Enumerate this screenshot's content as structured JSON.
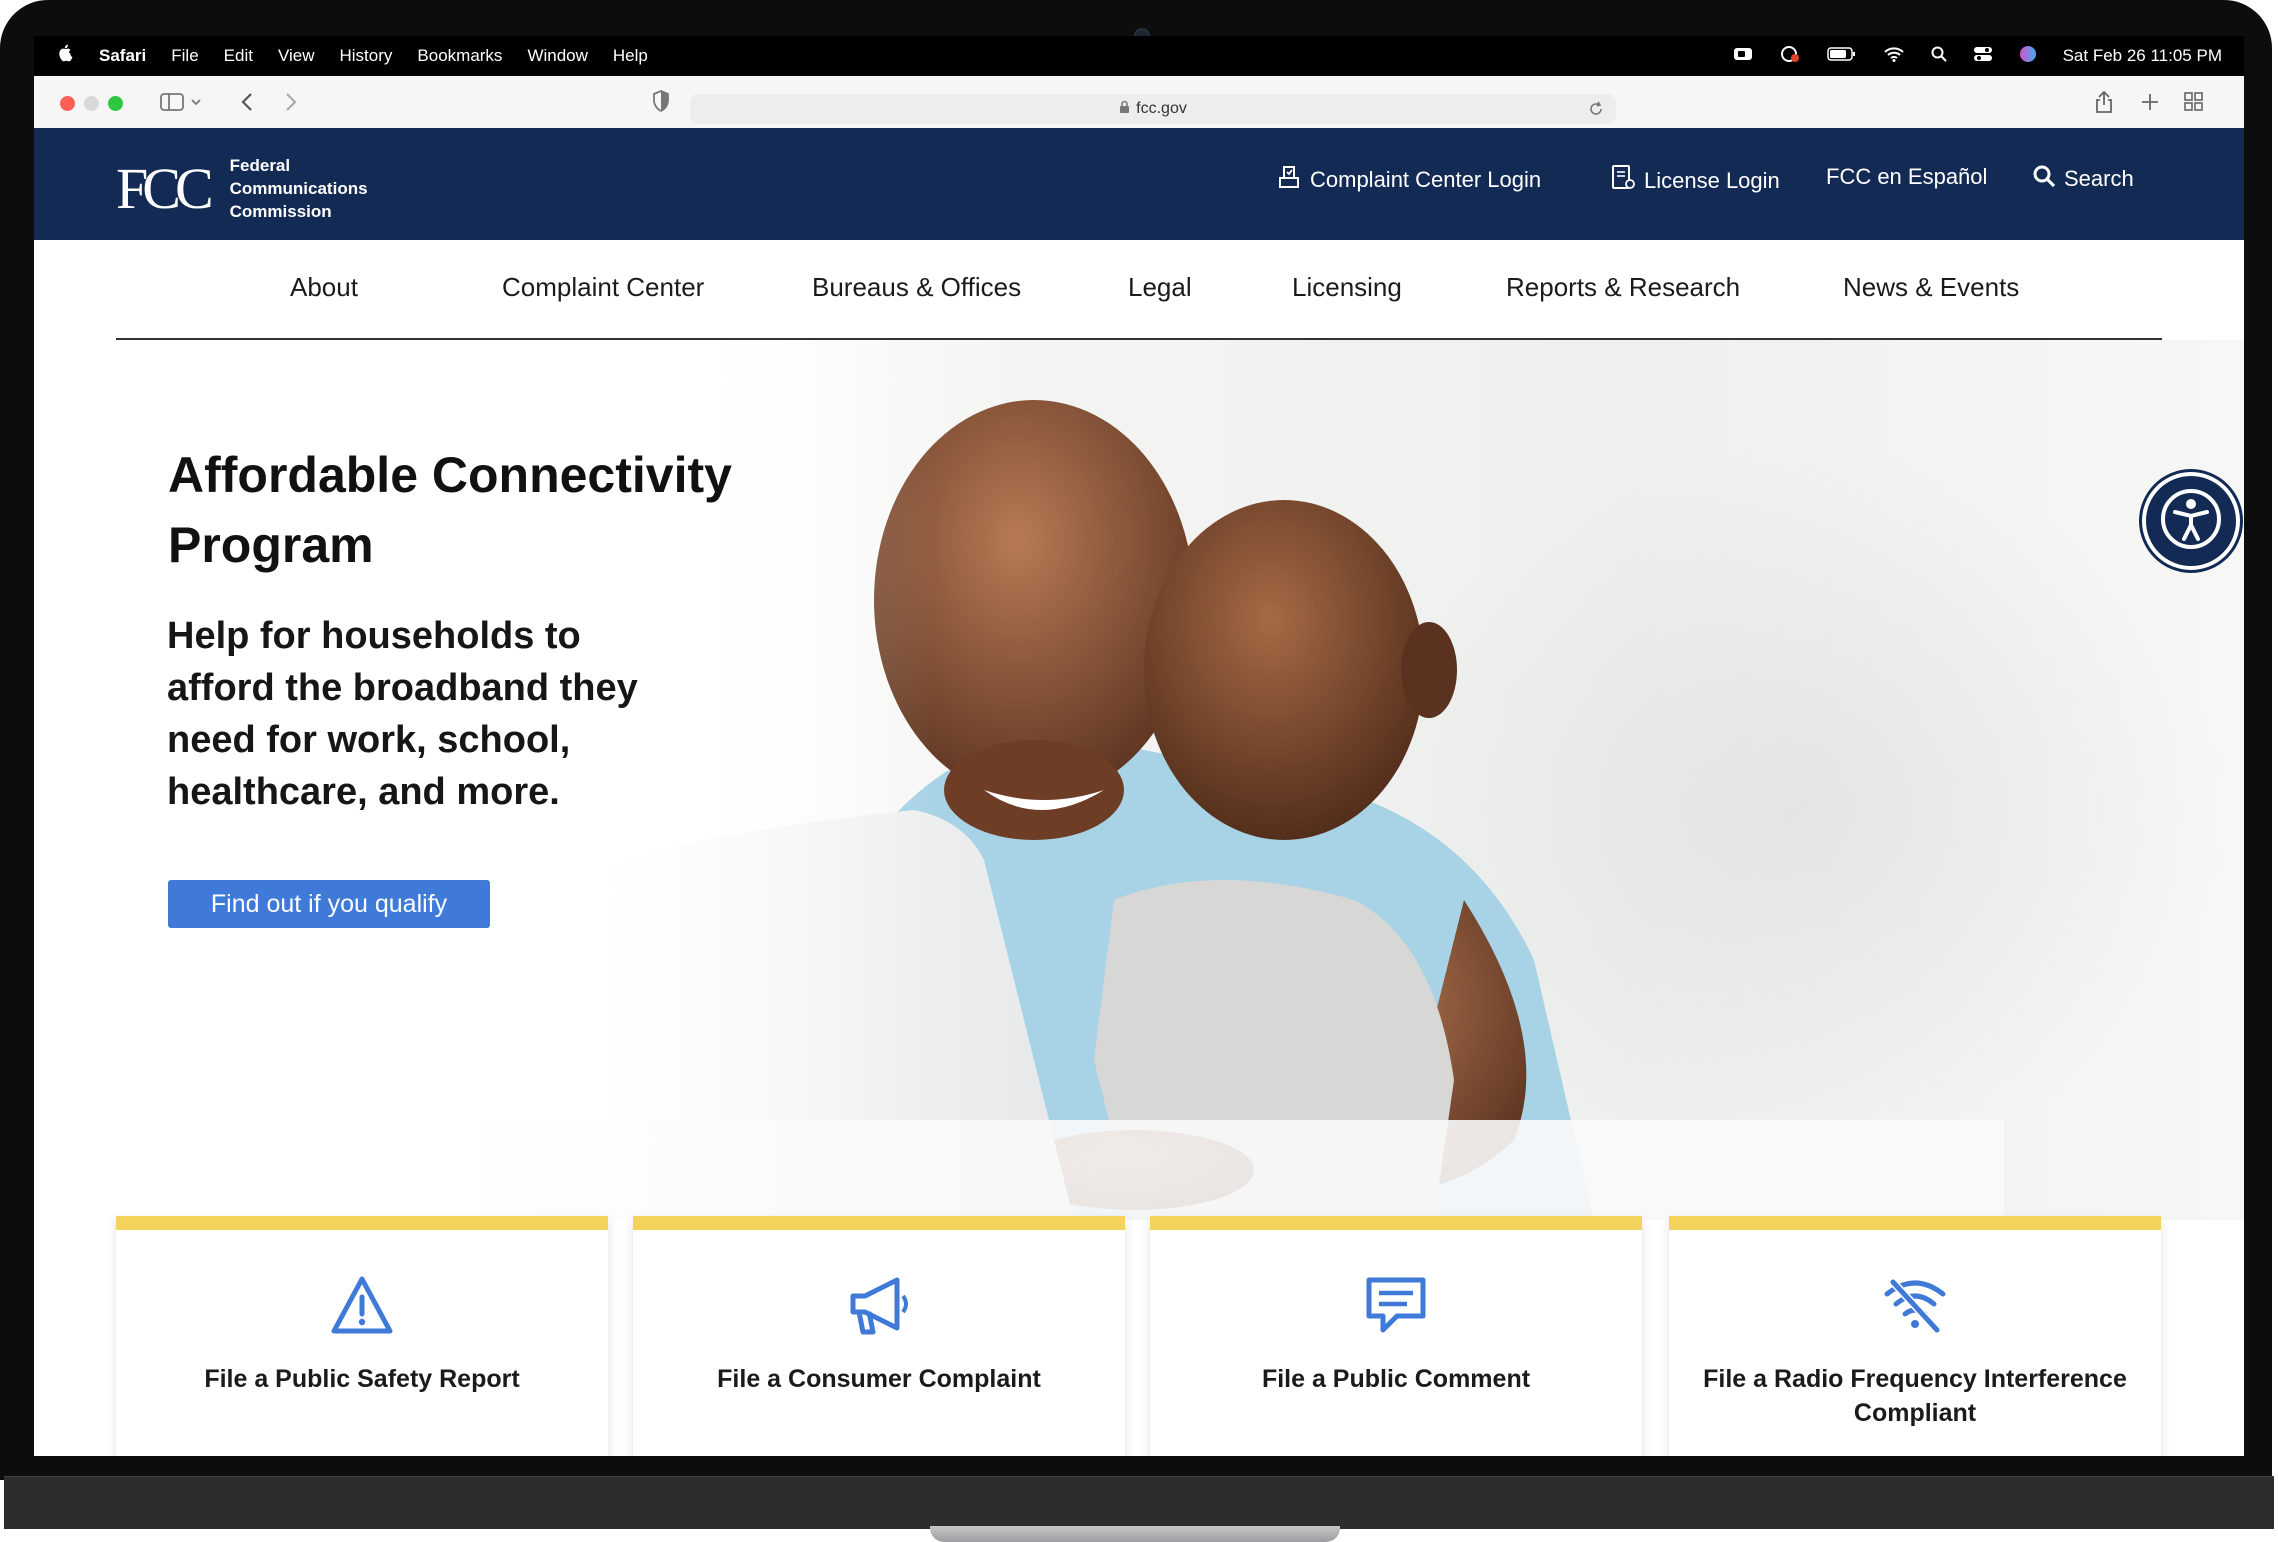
{
  "menubar": {
    "app_name": "Safari",
    "items": [
      "File",
      "Edit",
      "View",
      "History",
      "Bookmarks",
      "Window",
      "Help"
    ],
    "datetime": "Sat Feb 26  11:05 PM"
  },
  "browser": {
    "url": "fcc.gov"
  },
  "header": {
    "logo_mark": "FCC",
    "org_name_line1": "Federal",
    "org_name_line2": "Communications",
    "org_name_line3": "Commission",
    "complaint_login": "Complaint Center Login",
    "license_login": "License Login",
    "spanish": "FCC en Español",
    "search": "Search"
  },
  "nav": {
    "items": [
      "About",
      "Complaint Center",
      "Bureaus & Offices",
      "Legal",
      "Licensing",
      "Reports & Research",
      "News & Events"
    ]
  },
  "hero": {
    "title": "Affordable Connectivity Program",
    "subtitle": "Help for households to afford the broadband they need for work, school, healthcare, and more.",
    "cta": "Find out if you qualify"
  },
  "cards": [
    {
      "label": "File a Public Safety Report",
      "icon": "warning-icon"
    },
    {
      "label": "File a Consumer Complaint",
      "icon": "megaphone-icon"
    },
    {
      "label": "File a Public Comment",
      "icon": "comment-icon"
    },
    {
      "label": "File a Radio Frequency Interference Compliant",
      "icon": "no-signal-icon"
    }
  ],
  "colors": {
    "header_bg": "#132a55",
    "accent_blue": "#3f7ad9",
    "card_top": "#f3d35c"
  }
}
